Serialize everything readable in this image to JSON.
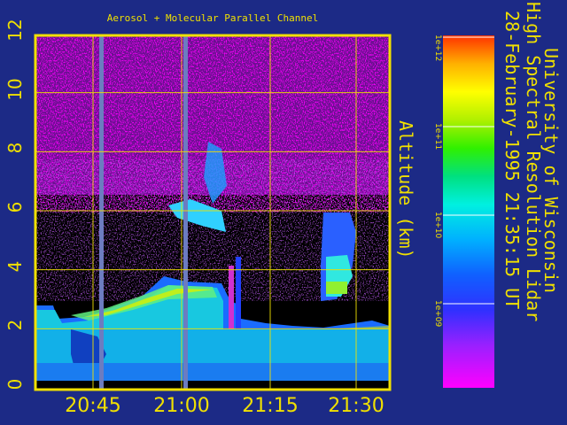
{
  "chart_data": {
    "type": "heatmap",
    "title": "Aerosol + Molecular Parallel Channel",
    "ylabel": "Altitude (km)",
    "ylim": [
      0,
      12
    ],
    "yticks": [
      "0",
      "2",
      "4",
      "6",
      "8",
      "10",
      "12"
    ],
    "xticks": [
      "20:45",
      "21:00",
      "21:15",
      "21:30"
    ],
    "grid": true,
    "colorbar": {
      "ticks": [
        "1e+09",
        "1e+10",
        "1e+11",
        "1e+12"
      ],
      "scale": "log"
    },
    "side_text": [
      "University of Wisconsin",
      "High Spectral Resolution Lidar",
      "28-February-1995 21:35:15 UT"
    ]
  },
  "colors": {
    "background": "#1c2a86",
    "text": "#f0e000",
    "frame": "#f0e000"
  }
}
